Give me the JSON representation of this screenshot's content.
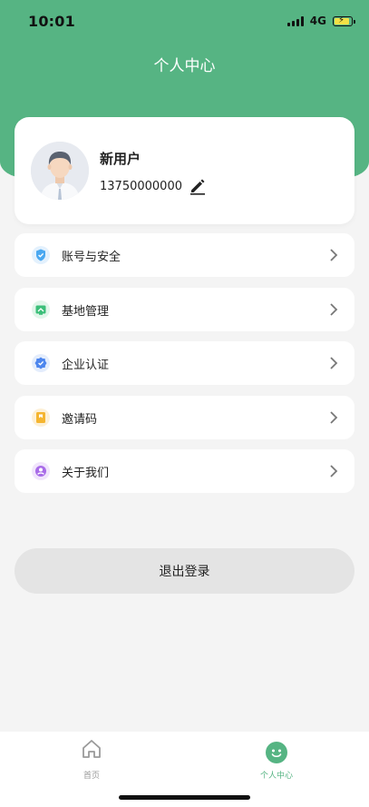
{
  "status_bar": {
    "time": "10:01",
    "network": "4G"
  },
  "page": {
    "title": "个人中心"
  },
  "profile": {
    "name": "新用户",
    "phone": "13750000000"
  },
  "menu": [
    {
      "label": "账号与安全",
      "icon": "shield-icon",
      "color": "#4aa8f0"
    },
    {
      "label": "基地管理",
      "icon": "base-icon",
      "color": "#3cbf79"
    },
    {
      "label": "企业认证",
      "icon": "verified-icon",
      "color": "#4d86ee"
    },
    {
      "label": "邀请码",
      "icon": "invite-icon",
      "color": "#f5b530"
    },
    {
      "label": "关于我们",
      "icon": "about-icon",
      "color": "#a86be8"
    }
  ],
  "logout": {
    "label": "退出登录"
  },
  "tabbar": {
    "tabs": [
      {
        "label": "首页",
        "icon": "home-icon",
        "active": false
      },
      {
        "label": "个人中心",
        "icon": "smile-icon",
        "active": true
      }
    ]
  },
  "colors": {
    "brand": "#56b483",
    "inactive": "#9a9a9a"
  }
}
